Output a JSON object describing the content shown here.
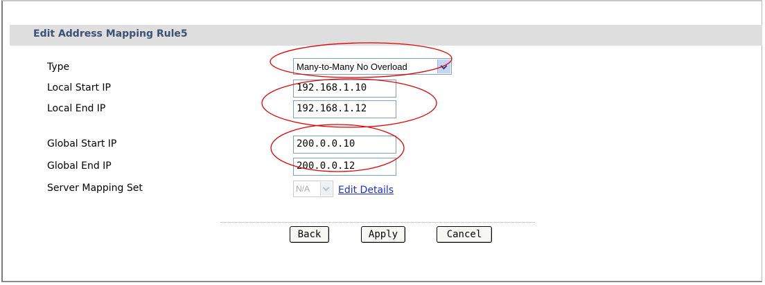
{
  "title": "Edit Address Mapping Rule5",
  "labels": {
    "type": "Type",
    "local_start": "Local Start IP",
    "local_end": "Local End IP",
    "global_start": "Global Start IP",
    "global_end": "Global End IP",
    "server_mapping": "Server Mapping Set"
  },
  "fields": {
    "type_value": "Many-to-Many No Overload",
    "local_start": "192.168.1.10",
    "local_end": "192.168.1.12",
    "global_start": "200.0.0.10",
    "global_end": "200.0.0.12",
    "server_mapping_value": "N/A"
  },
  "links": {
    "edit_details": "Edit Details"
  },
  "buttons": {
    "back": "Back",
    "apply": "Apply",
    "cancel": "Cancel"
  },
  "colors": {
    "title_text": "#3a5275",
    "title_bar": "#dedede",
    "annotation": "#e00000",
    "link": "#1a2ecf"
  }
}
